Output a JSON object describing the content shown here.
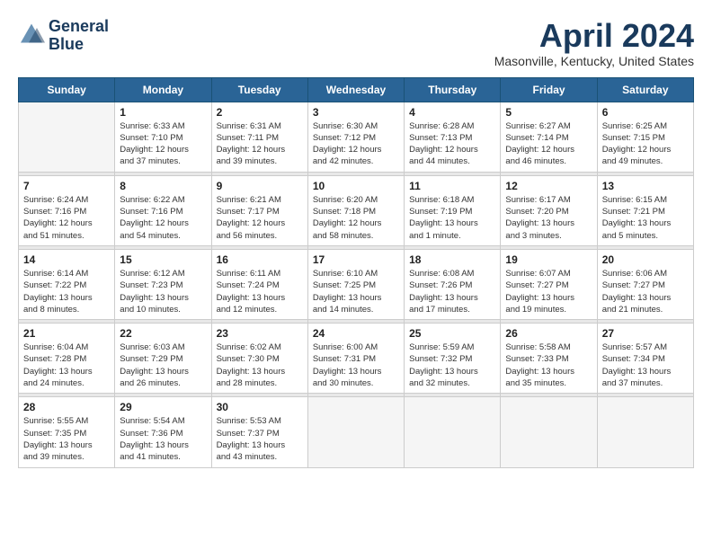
{
  "header": {
    "logo_line1": "General",
    "logo_line2": "Blue",
    "title": "April 2024",
    "location": "Masonville, Kentucky, United States"
  },
  "weekdays": [
    "Sunday",
    "Monday",
    "Tuesday",
    "Wednesday",
    "Thursday",
    "Friday",
    "Saturday"
  ],
  "weeks": [
    [
      {
        "day": "",
        "info": ""
      },
      {
        "day": "1",
        "info": "Sunrise: 6:33 AM\nSunset: 7:10 PM\nDaylight: 12 hours\nand 37 minutes."
      },
      {
        "day": "2",
        "info": "Sunrise: 6:31 AM\nSunset: 7:11 PM\nDaylight: 12 hours\nand 39 minutes."
      },
      {
        "day": "3",
        "info": "Sunrise: 6:30 AM\nSunset: 7:12 PM\nDaylight: 12 hours\nand 42 minutes."
      },
      {
        "day": "4",
        "info": "Sunrise: 6:28 AM\nSunset: 7:13 PM\nDaylight: 12 hours\nand 44 minutes."
      },
      {
        "day": "5",
        "info": "Sunrise: 6:27 AM\nSunset: 7:14 PM\nDaylight: 12 hours\nand 46 minutes."
      },
      {
        "day": "6",
        "info": "Sunrise: 6:25 AM\nSunset: 7:15 PM\nDaylight: 12 hours\nand 49 minutes."
      }
    ],
    [
      {
        "day": "7",
        "info": "Sunrise: 6:24 AM\nSunset: 7:16 PM\nDaylight: 12 hours\nand 51 minutes."
      },
      {
        "day": "8",
        "info": "Sunrise: 6:22 AM\nSunset: 7:16 PM\nDaylight: 12 hours\nand 54 minutes."
      },
      {
        "day": "9",
        "info": "Sunrise: 6:21 AM\nSunset: 7:17 PM\nDaylight: 12 hours\nand 56 minutes."
      },
      {
        "day": "10",
        "info": "Sunrise: 6:20 AM\nSunset: 7:18 PM\nDaylight: 12 hours\nand 58 minutes."
      },
      {
        "day": "11",
        "info": "Sunrise: 6:18 AM\nSunset: 7:19 PM\nDaylight: 13 hours\nand 1 minute."
      },
      {
        "day": "12",
        "info": "Sunrise: 6:17 AM\nSunset: 7:20 PM\nDaylight: 13 hours\nand 3 minutes."
      },
      {
        "day": "13",
        "info": "Sunrise: 6:15 AM\nSunset: 7:21 PM\nDaylight: 13 hours\nand 5 minutes."
      }
    ],
    [
      {
        "day": "14",
        "info": "Sunrise: 6:14 AM\nSunset: 7:22 PM\nDaylight: 13 hours\nand 8 minutes."
      },
      {
        "day": "15",
        "info": "Sunrise: 6:12 AM\nSunset: 7:23 PM\nDaylight: 13 hours\nand 10 minutes."
      },
      {
        "day": "16",
        "info": "Sunrise: 6:11 AM\nSunset: 7:24 PM\nDaylight: 13 hours\nand 12 minutes."
      },
      {
        "day": "17",
        "info": "Sunrise: 6:10 AM\nSunset: 7:25 PM\nDaylight: 13 hours\nand 14 minutes."
      },
      {
        "day": "18",
        "info": "Sunrise: 6:08 AM\nSunset: 7:26 PM\nDaylight: 13 hours\nand 17 minutes."
      },
      {
        "day": "19",
        "info": "Sunrise: 6:07 AM\nSunset: 7:27 PM\nDaylight: 13 hours\nand 19 minutes."
      },
      {
        "day": "20",
        "info": "Sunrise: 6:06 AM\nSunset: 7:27 PM\nDaylight: 13 hours\nand 21 minutes."
      }
    ],
    [
      {
        "day": "21",
        "info": "Sunrise: 6:04 AM\nSunset: 7:28 PM\nDaylight: 13 hours\nand 24 minutes."
      },
      {
        "day": "22",
        "info": "Sunrise: 6:03 AM\nSunset: 7:29 PM\nDaylight: 13 hours\nand 26 minutes."
      },
      {
        "day": "23",
        "info": "Sunrise: 6:02 AM\nSunset: 7:30 PM\nDaylight: 13 hours\nand 28 minutes."
      },
      {
        "day": "24",
        "info": "Sunrise: 6:00 AM\nSunset: 7:31 PM\nDaylight: 13 hours\nand 30 minutes."
      },
      {
        "day": "25",
        "info": "Sunrise: 5:59 AM\nSunset: 7:32 PM\nDaylight: 13 hours\nand 32 minutes."
      },
      {
        "day": "26",
        "info": "Sunrise: 5:58 AM\nSunset: 7:33 PM\nDaylight: 13 hours\nand 35 minutes."
      },
      {
        "day": "27",
        "info": "Sunrise: 5:57 AM\nSunset: 7:34 PM\nDaylight: 13 hours\nand 37 minutes."
      }
    ],
    [
      {
        "day": "28",
        "info": "Sunrise: 5:55 AM\nSunset: 7:35 PM\nDaylight: 13 hours\nand 39 minutes."
      },
      {
        "day": "29",
        "info": "Sunrise: 5:54 AM\nSunset: 7:36 PM\nDaylight: 13 hours\nand 41 minutes."
      },
      {
        "day": "30",
        "info": "Sunrise: 5:53 AM\nSunset: 7:37 PM\nDaylight: 13 hours\nand 43 minutes."
      },
      {
        "day": "",
        "info": ""
      },
      {
        "day": "",
        "info": ""
      },
      {
        "day": "",
        "info": ""
      },
      {
        "day": "",
        "info": ""
      }
    ]
  ]
}
